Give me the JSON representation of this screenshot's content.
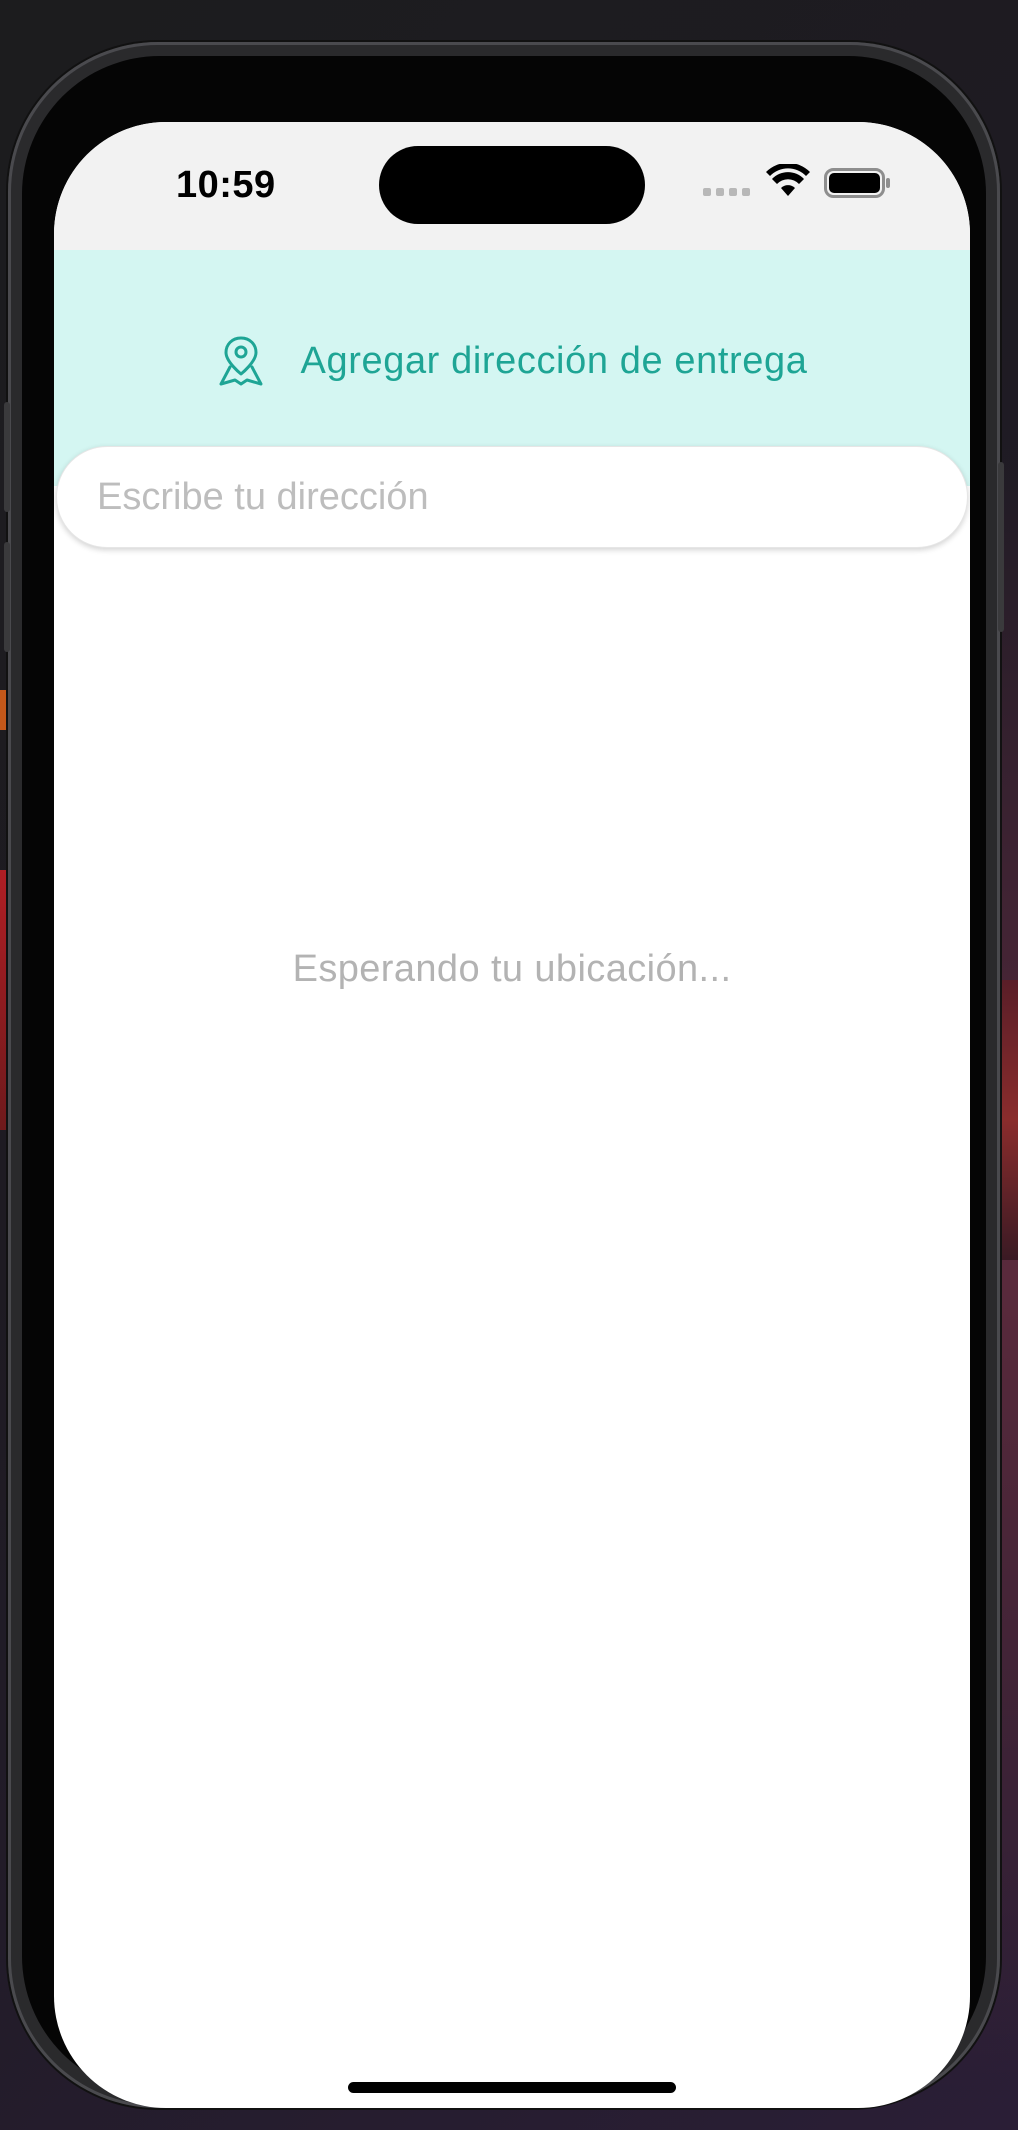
{
  "status_bar": {
    "time": "10:59",
    "icons": [
      "cell-signal-icon",
      "wifi-icon",
      "battery-icon"
    ]
  },
  "header": {
    "icon": "map-pin-icon",
    "title": "Agregar dirección de entrega",
    "accent_color": "#1ea595",
    "background_color": "#d4f6f2"
  },
  "search": {
    "placeholder": "Escribe tu dirección",
    "value": ""
  },
  "main": {
    "status_message": "Esperando tu ubicación..."
  }
}
